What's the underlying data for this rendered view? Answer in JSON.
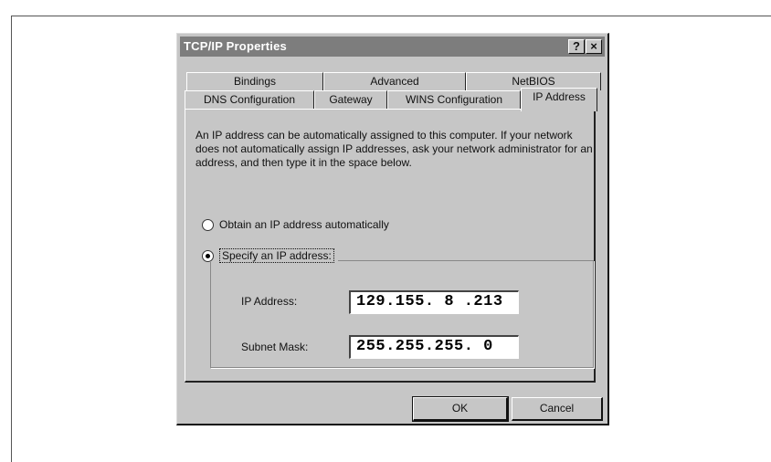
{
  "dialog": {
    "title": "TCP/IP Properties",
    "help_button": "?",
    "close_button": "×"
  },
  "tabs": {
    "row1": [
      "Bindings",
      "Advanced",
      "NetBIOS"
    ],
    "row2": [
      "DNS Configuration",
      "Gateway",
      "WINS Configuration"
    ],
    "active": "IP Address"
  },
  "panel": {
    "description": "An IP address can be automatically assigned to this computer. If your network does not automatically assign IP addresses, ask your network administrator for an address, and then type it in the space below.",
    "option_auto": "Obtain an IP address automatically",
    "option_specify": "Specify an IP address:",
    "selected_option": "specify",
    "ip_label": "IP Address:",
    "ip_value": "129.155. 8 .213",
    "subnet_label": "Subnet Mask:",
    "subnet_value": "255.255.255. 0"
  },
  "buttons": {
    "ok": "OK",
    "cancel": "Cancel"
  },
  "colors": {
    "dialog_bg": "#c6c6c6",
    "titlebar": "#7d7d7d"
  }
}
